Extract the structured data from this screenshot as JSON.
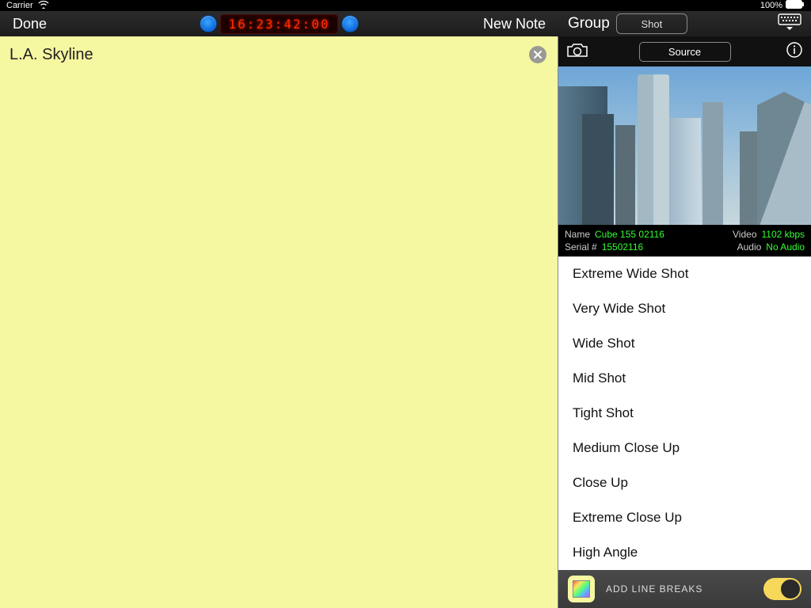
{
  "statusbar": {
    "carrier": "Carrier",
    "battery_pct": "100%"
  },
  "header": {
    "done": "Done",
    "timecode": "16:23:42:00",
    "new_note": "New Note",
    "group_label": "Group",
    "group_value": "Shot"
  },
  "note": {
    "title": "L.A. Skyline"
  },
  "preview": {
    "source_label": "Source"
  },
  "meta": {
    "name_label": "Name",
    "name_value": "Cube 155 02116",
    "serial_label": "Serial #",
    "serial_value": "15502116",
    "video_label": "Video",
    "video_value": "1102 kbps",
    "audio_label": "Audio",
    "audio_value": "No Audio"
  },
  "shots": [
    "Extreme Wide Shot",
    "Very Wide Shot",
    "Wide Shot",
    "Mid Shot",
    "Tight Shot",
    "Medium Close Up",
    "Close Up",
    "Extreme Close Up",
    "High Angle"
  ],
  "footer": {
    "label": "ADD LINE BREAKS"
  }
}
